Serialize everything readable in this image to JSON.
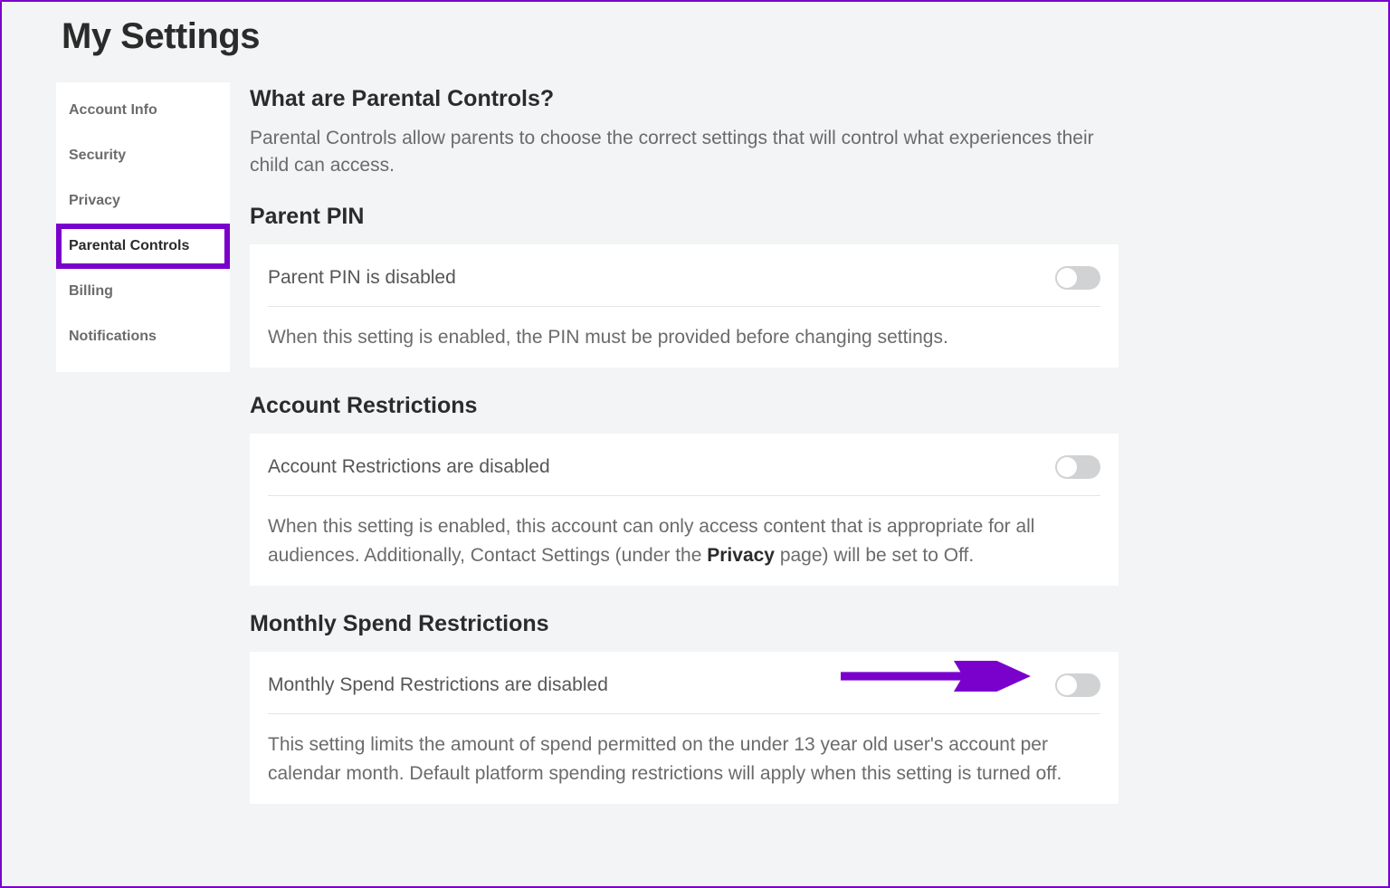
{
  "page_title": "My Settings",
  "sidebar": {
    "items": [
      {
        "label": "Account Info",
        "active": false
      },
      {
        "label": "Security",
        "active": false
      },
      {
        "label": "Privacy",
        "active": false
      },
      {
        "label": "Parental Controls",
        "active": true
      },
      {
        "label": "Billing",
        "active": false
      },
      {
        "label": "Notifications",
        "active": false
      }
    ]
  },
  "intro": {
    "heading": "What are Parental Controls?",
    "body": "Parental Controls allow parents to choose the correct settings that will control what experiences their child can access."
  },
  "sections": {
    "parent_pin": {
      "heading": "Parent PIN",
      "status_label": "Parent PIN is disabled",
      "toggle_on": false,
      "desc": "When this setting is enabled, the PIN must be provided before changing settings."
    },
    "account_restrictions": {
      "heading": "Account Restrictions",
      "status_label": "Account Restrictions are disabled",
      "toggle_on": false,
      "desc_pre": "When this setting is enabled, this account can only access content that is appropriate for all audiences. Additionally, Contact Settings (under the ",
      "desc_bold": "Privacy",
      "desc_post": " page) will be set to Off."
    },
    "monthly_spend": {
      "heading": "Monthly Spend Restrictions",
      "status_label": "Monthly Spend Restrictions are disabled",
      "toggle_on": false,
      "desc": "This setting limits the amount of spend permitted on the under 13 year old user's account per calendar month. Default platform spending restrictions will apply when this setting is turned off."
    }
  },
  "annotations": {
    "highlight_color": "#7a00cc",
    "arrow_target": "monthly-spend-toggle"
  }
}
